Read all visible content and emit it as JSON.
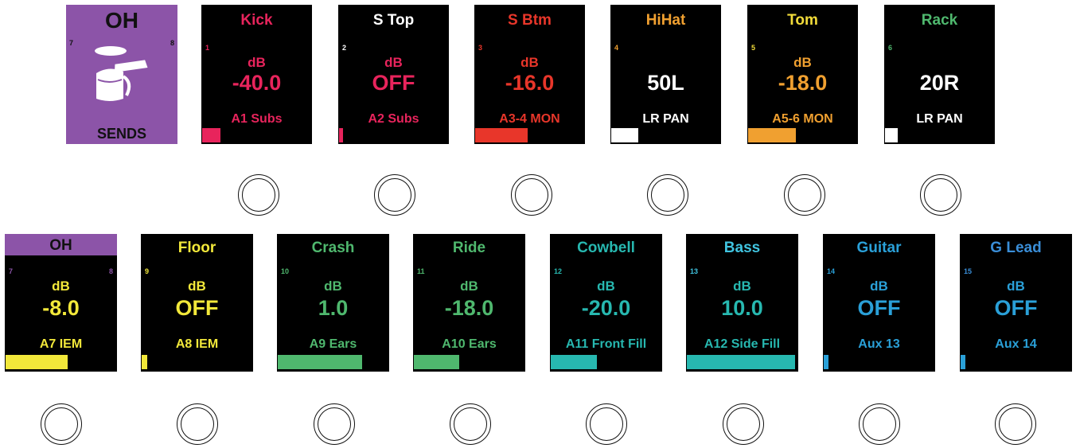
{
  "sends_tile": {
    "title": "OH",
    "left_channel": "7",
    "right_channel": "8",
    "label": "SENDS",
    "icon": "drum-overhead-icon",
    "color": "#8c54a8"
  },
  "top_strips": [
    {
      "name": "Kick",
      "channel": "1",
      "unit": "dB",
      "value": "-40.0",
      "dest": "A1 Subs",
      "color": "#e8245c",
      "meter_level": 0.17
    },
    {
      "name": "S Top",
      "channel": "2",
      "unit": "dB",
      "value": "OFF",
      "dest": "A2 Subs",
      "name_color": "#ffffff",
      "color": "#e8245c",
      "meter_level": 0.04
    },
    {
      "name": "S Btm",
      "channel": "3",
      "unit": "dB",
      "value": "-16.0",
      "dest": "A3-4 MON",
      "color": "#e8362a",
      "meter_level": 0.48
    },
    {
      "name": "HiHat",
      "channel": "4",
      "unit": "",
      "value": "50L",
      "dest": "LR PAN",
      "name_color": "#f0a030",
      "color": "#ffffff",
      "meter_level": 0.25
    },
    {
      "name": "Tom",
      "channel": "5",
      "unit": "dB",
      "value": "-18.0",
      "dest": "A5-6 MON",
      "name_color": "#f2dc3a",
      "color": "#f0a030",
      "meter_level": 0.44
    },
    {
      "name": "Rack",
      "channel": "6",
      "unit": "",
      "value": "20R",
      "dest": "LR PAN",
      "name_color": "#4fb86e",
      "color": "#ffffff",
      "meter_level": 0.12
    }
  ],
  "bottom_strips": [
    {
      "name": "OH",
      "channel": "7",
      "channel_right": "8",
      "unit": "dB",
      "value": "-8.0",
      "dest": "A7 IEM",
      "color": "#f2e83a",
      "meter_level": 0.56
    },
    {
      "name": "Floor",
      "channel": "9",
      "unit": "dB",
      "value": "OFF",
      "dest": "A8 IEM",
      "color": "#f2e83a",
      "meter_level": 0.05
    },
    {
      "name": "Crash",
      "channel": "10",
      "unit": "dB",
      "value": "1.0",
      "dest": "A9 Ears",
      "color": "#4fb86e",
      "meter_level": 0.76
    },
    {
      "name": "Ride",
      "channel": "11",
      "unit": "dB",
      "value": "-18.0",
      "dest": "A10 Ears",
      "color": "#4fb86e",
      "meter_level": 0.41
    },
    {
      "name": "Cowbell",
      "channel": "12",
      "unit": "dB",
      "value": "-20.0",
      "dest": "A11 Front Fill",
      "color": "#27b8b0",
      "meter_level": 0.42
    },
    {
      "name": "Bass",
      "channel": "13",
      "unit": "dB",
      "value": "10.0",
      "dest": "A12 Side Fill",
      "color": "#27b8b0",
      "name_color": "#40c4e0",
      "meter_level": 0.98
    },
    {
      "name": "Guitar",
      "channel": "14",
      "unit": "dB",
      "value": "OFF",
      "dest": "Aux 13",
      "color": "#2aa0d8",
      "meter_level": 0.04
    },
    {
      "name": "G Lead",
      "channel": "15",
      "unit": "dB",
      "value": "OFF",
      "dest": "Aux 14",
      "color": "#2aa0d8",
      "name_color": "#3a8ed8",
      "meter_level": 0.04
    }
  ]
}
